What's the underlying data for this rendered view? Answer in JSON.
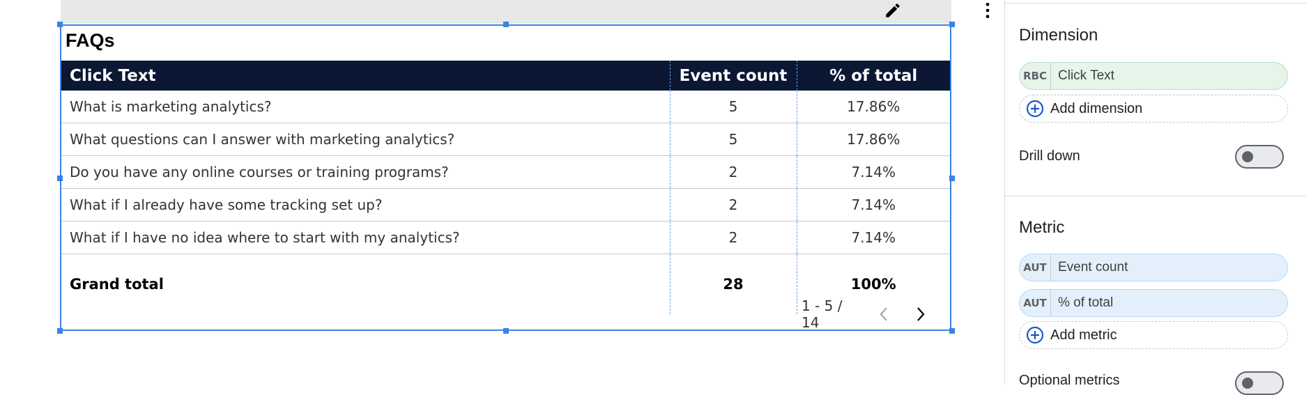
{
  "table": {
    "title": "FAQs",
    "headers": [
      "Click Text",
      "Event count",
      "% of total"
    ],
    "rows": [
      [
        "What is marketing analytics?",
        "5",
        "17.86%"
      ],
      [
        "What questions can I answer with marketing analytics?",
        "5",
        "17.86%"
      ],
      [
        "Do you have any online courses or training programs?",
        "2",
        "7.14%"
      ],
      [
        "What if I already have some tracking set up?",
        "2",
        "7.14%"
      ],
      [
        "What if I have no idea where to start with my analytics?",
        "2",
        "7.14%"
      ]
    ],
    "grand_total": {
      "label": "Grand total",
      "event_count": "28",
      "percent": "100%"
    },
    "pagination": "1 - 5 / 14",
    "colors": {
      "header_bg": "#0b1733",
      "selection": "#3b82e6"
    }
  },
  "toolbar": {
    "edit_icon": "pencil-icon",
    "more_icon": "more-vert-icon"
  },
  "panel": {
    "dimension": {
      "title": "Dimension",
      "chip": {
        "type": "RBC",
        "label": "Click Text"
      },
      "add_label": "Add dimension"
    },
    "drill_down": {
      "label": "Drill down",
      "enabled": false
    },
    "metric": {
      "title": "Metric",
      "chips": [
        {
          "type": "AUT",
          "label": "Event count"
        },
        {
          "type": "AUT",
          "label": "% of total"
        }
      ],
      "add_label": "Add metric"
    },
    "optional_metrics": {
      "label": "Optional metrics",
      "enabled": false
    }
  }
}
